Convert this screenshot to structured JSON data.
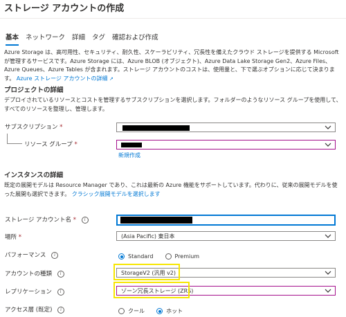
{
  "page": {
    "title": "ストレージ アカウントの作成"
  },
  "tabs": [
    {
      "label": "基本",
      "active": true
    },
    {
      "label": "ネットワーク"
    },
    {
      "label": "詳細"
    },
    {
      "label": "タグ"
    },
    {
      "label": "確認および作成"
    }
  ],
  "intro": {
    "text": "Azure Storage は、高可用性、セキュリティ、耐久性、スケーラビリティ、冗長性を備えたクラウド ストレージを提供する Microsoft が管理するサービスです。Azure Storage には、Azure BLOB (オブジェクト)、Azure Data Lake Storage Gen2、Azure Files、Azure Queues、Azure Tables が含まれます。ストレージ アカウントのコストは、使用量と、下で選ぶオプションに応じて決まります。",
    "link": "Azure ストレージ アカウントの詳細"
  },
  "project": {
    "heading": "プロジェクトの詳細",
    "description": "デプロイされているリソースとコストを管理するサブスクリプションを選択します。フォルダーのようなリソース グループを使用して、すべてのリソースを整理し、管理します。",
    "subscription_label": "サブスクリプション",
    "resource_group_label": "リソース グループ",
    "create_new": "新規作成"
  },
  "instance": {
    "heading": "インスタンスの詳細",
    "description": "既定の展開モデルは Resource Manager であり、これは最新の Azure 機能をサポートしています。代わりに、従来の展開モデルを使った展開も選択できます。",
    "classic_link": "クラシック展開モデルを選択します",
    "account_name_label": "ストレージ アカウント名",
    "location_label": "場所",
    "location_value": "(Asia Pacific) 東日本",
    "performance_label": "パフォーマンス",
    "performance_options": [
      "Standard",
      "Premium"
    ],
    "performance_selected": "Standard",
    "account_kind_label": "アカウントの種類",
    "account_kind_value": "StorageV2 (汎用 v2)",
    "replication_label": "レプリケーション",
    "replication_value": "ゾーン冗長ストレージ (ZRS)",
    "access_tier_label": "アクセス層 (既定)",
    "access_tier_options": [
      "クール",
      "ホット"
    ],
    "access_tier_selected": "ホット"
  },
  "symbols": {
    "required": "*",
    "info": "i",
    "external_link_icon": "↗"
  },
  "colors": {
    "accent": "#0078d4",
    "highlight": "#f7e600",
    "invalid_border": "#a4108c",
    "required": "#a4262c"
  }
}
